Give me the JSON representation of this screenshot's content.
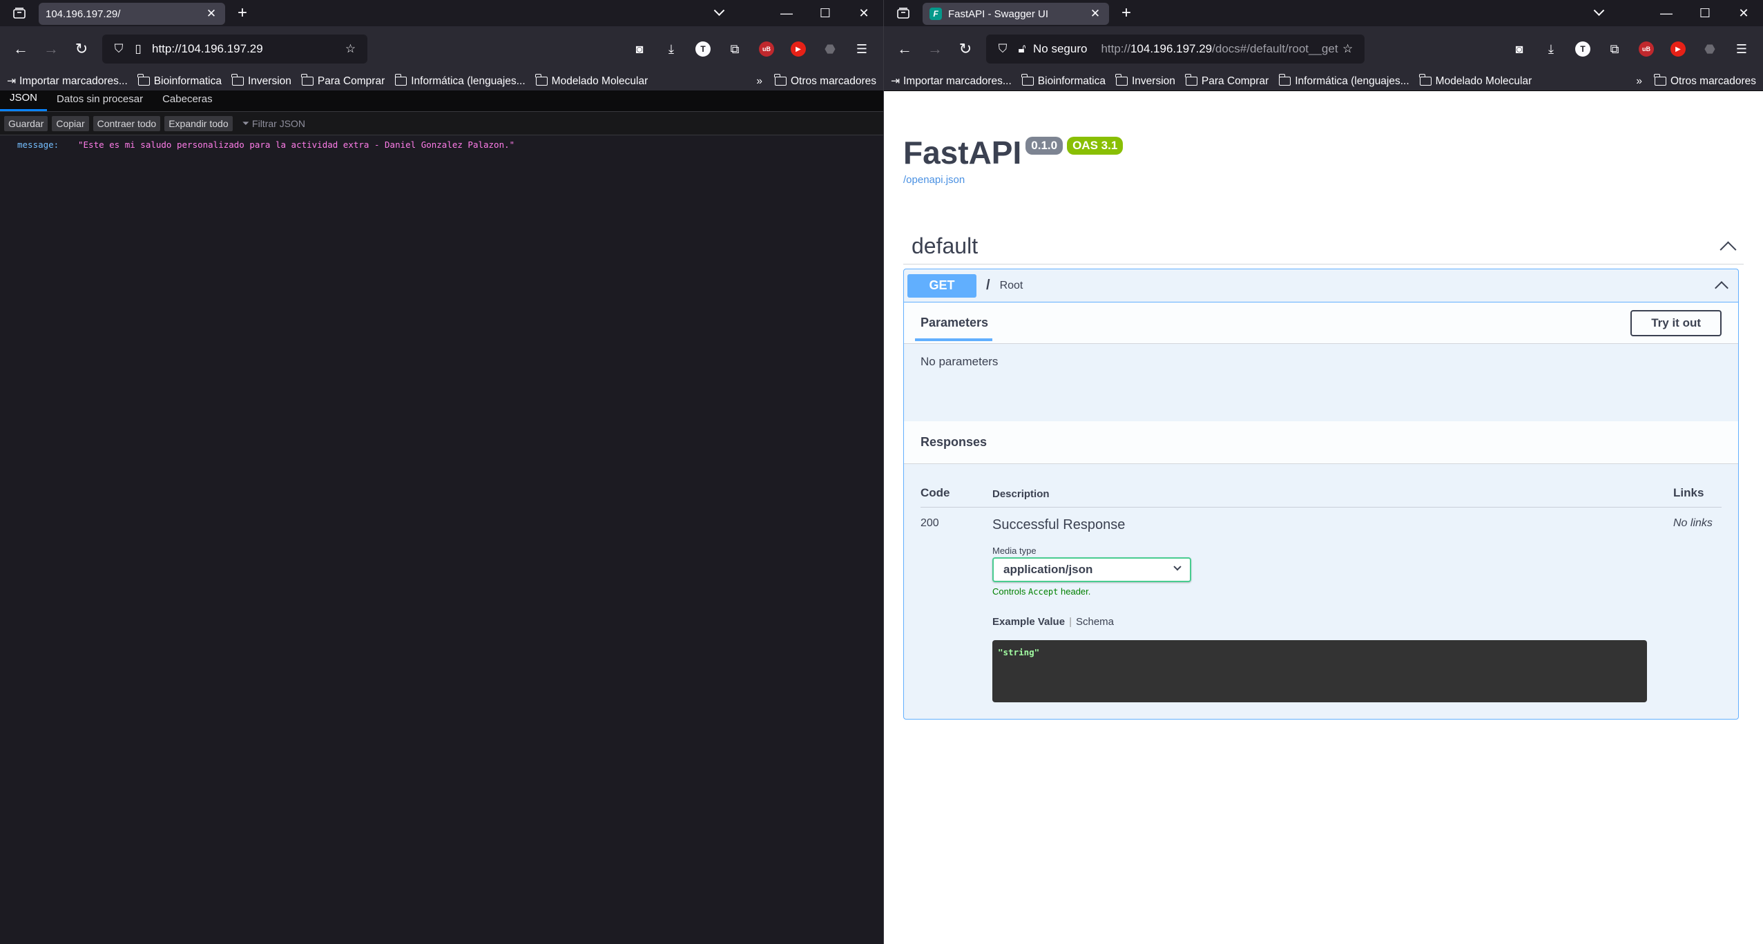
{
  "left": {
    "tab_title": "104.196.197.29/",
    "url": "http://104.196.197.29",
    "bookmarks": [
      "Importar marcadores...",
      "Bioinformatica",
      "Inversion",
      "Para Comprar",
      "Informática (lenguajes...",
      "Modelado Molecular"
    ],
    "other_bookmarks": "Otros marcadores",
    "viewer_tabs": [
      "JSON",
      "Datos sin procesar",
      "Cabeceras"
    ],
    "toolbar_buttons": [
      "Guardar",
      "Copiar",
      "Contraer todo",
      "Expandir todo"
    ],
    "filter_placeholder": "Filtrar JSON",
    "json": {
      "key": "message:",
      "value": "\"Este es mi saludo personalizado para la actividad extra - Daniel Gonzalez Palazon.\""
    }
  },
  "right": {
    "tab_title": "FastAPI - Swagger UI",
    "security_text": "No seguro",
    "url_prefix": "http://",
    "url_host": "104.196.197.29",
    "url_path": "/docs#/default/root__get",
    "bookmarks": [
      "Importar marcadores...",
      "Bioinformatica",
      "Inversion",
      "Para Comprar",
      "Informática (lenguajes...",
      "Modelado Molecular"
    ],
    "other_bookmarks": "Otros marcadores",
    "swagger": {
      "title": "FastAPI",
      "version": "0.1.0",
      "oas": "OAS 3.1",
      "openapi_link": "/openapi.json",
      "section": "default",
      "method": "GET",
      "path": "/",
      "summary": "Root",
      "parameters_tab": "Parameters",
      "try_it_out": "Try it out",
      "no_parameters": "No parameters",
      "responses_title": "Responses",
      "col_code": "Code",
      "col_description": "Description",
      "col_links": "Links",
      "response_code": "200",
      "response_desc": "Successful Response",
      "media_type_label": "Media type",
      "media_type": "application/json",
      "controls_prefix": "Controls ",
      "controls_code": "Accept",
      "controls_suffix": " header.",
      "example_value": "Example Value",
      "schema": "Schema",
      "example_code": "\"string\"",
      "no_links": "No links"
    }
  },
  "colors": {
    "get_blue": "#61affe",
    "oas_green": "#89bf04",
    "firefox_dark": "#1c1b22",
    "json_key": "#75bfff",
    "json_value": "#ff7de9"
  }
}
